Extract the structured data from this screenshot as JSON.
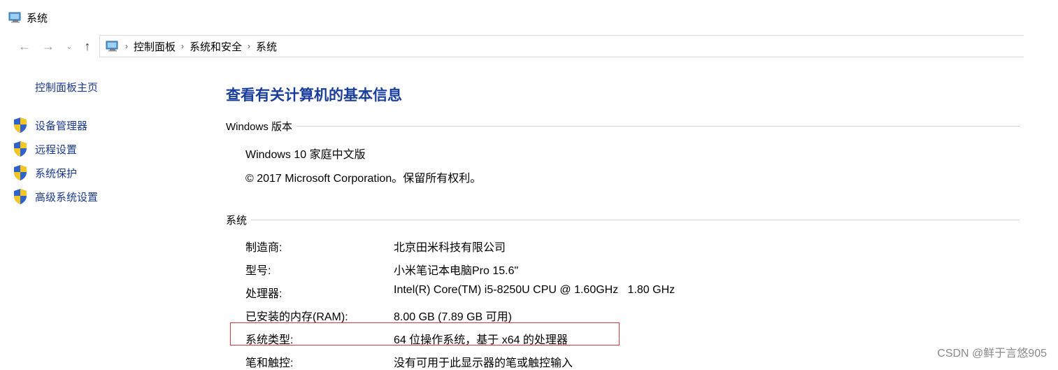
{
  "window": {
    "title": "系统"
  },
  "nav": {
    "back_label": "←",
    "forward_label": "→",
    "history_label": "⌄",
    "up_label": "↑",
    "breadcrumbs": [
      "控制面板",
      "系统和安全",
      "系统"
    ]
  },
  "sidebar": {
    "home_label": "控制面板主页",
    "items": [
      {
        "label": "设备管理器",
        "icon": "shield-icon"
      },
      {
        "label": "远程设置",
        "icon": "shield-icon"
      },
      {
        "label": "系统保护",
        "icon": "shield-icon"
      },
      {
        "label": "高级系统设置",
        "icon": "shield-icon"
      }
    ]
  },
  "main": {
    "title": "查看有关计算机的基本信息",
    "windows_section": {
      "header": "Windows 版本",
      "edition": "Windows 10 家庭中文版",
      "copyright": "© 2017 Microsoft Corporation。保留所有权利。"
    },
    "system_section": {
      "header": "系统",
      "rows": [
        {
          "label": "制造商:",
          "value": "北京田米科技有限公司"
        },
        {
          "label": "型号:",
          "value": "小米笔记本电脑Pro 15.6\""
        },
        {
          "label": "处理器:",
          "value": "Intel(R) Core(TM) i5-8250U CPU @ 1.60GHz   1.80 GHz"
        },
        {
          "label": "已安装的内存(RAM):",
          "value": "8.00 GB (7.89 GB 可用)"
        },
        {
          "label": "系统类型:",
          "value": "64 位操作系统，基于 x64 的处理器"
        },
        {
          "label": "笔和触控:",
          "value": "没有可用于此显示器的笔或触控输入"
        }
      ]
    }
  },
  "watermark": "CSDN @鲜于言悠905",
  "colors": {
    "link": "#1a3a8f",
    "title": "#1a3e9c",
    "highlight": "#e0383e"
  }
}
